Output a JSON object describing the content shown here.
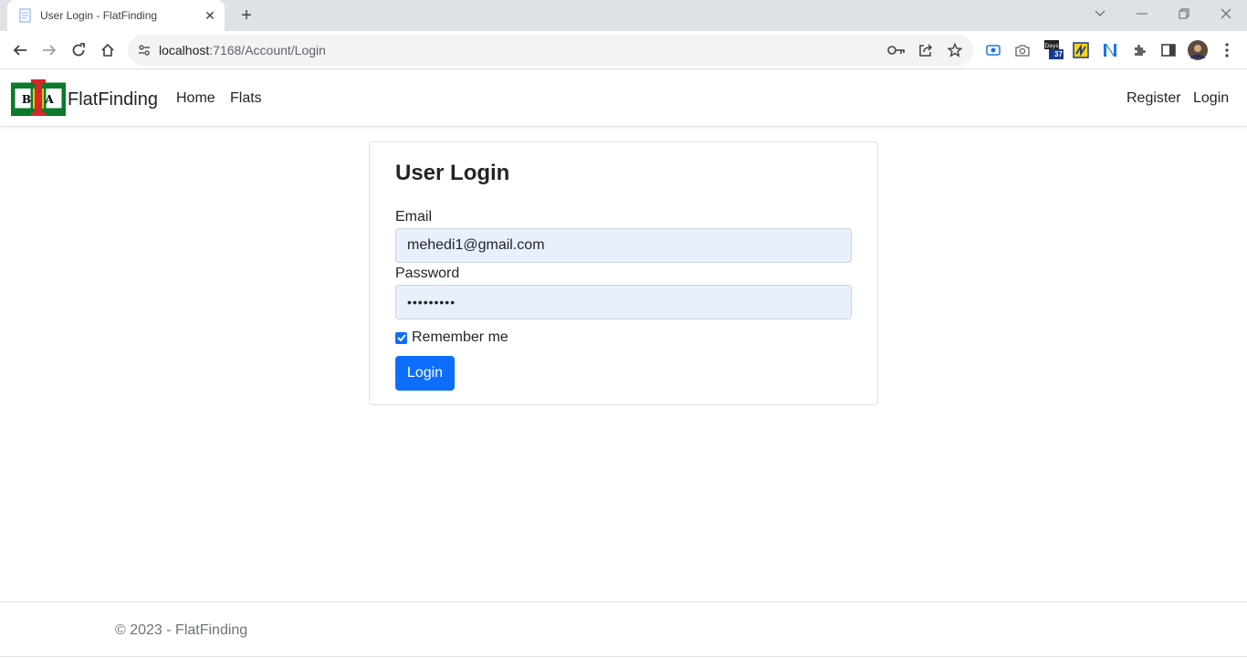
{
  "browser": {
    "tab_title": "User Login - FlatFinding",
    "url_host": "localhost",
    "url_path": ":7168/Account/Login",
    "extension_badge": "37"
  },
  "navbar": {
    "brand": "FlatFinding",
    "links": [
      {
        "label": "Home"
      },
      {
        "label": "Flats"
      }
    ],
    "right_links": [
      {
        "label": "Register"
      },
      {
        "label": "Login"
      }
    ]
  },
  "login": {
    "title": "User Login",
    "email_label": "Email",
    "email_value": "mehedi1@gmail.com",
    "password_label": "Password",
    "password_value": "•••••••••",
    "remember_label": "Remember me",
    "remember_checked": true,
    "submit_label": "Login"
  },
  "footer": {
    "text": "© 2023 - FlatFinding"
  },
  "colors": {
    "primary": "#0d6efd",
    "autofill_bg": "#e8f0fe",
    "chrome_bg": "#dee1e6"
  }
}
